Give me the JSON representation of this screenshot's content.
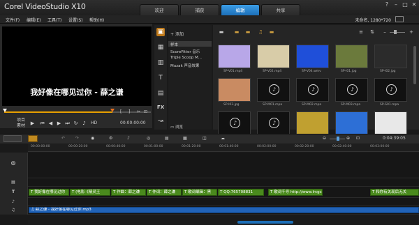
{
  "app": {
    "title": "Corel VideoStudio X10",
    "tabs": [
      {
        "label": "欢迎",
        "active": false
      },
      {
        "label": "捕获",
        "active": false
      },
      {
        "label": "编辑",
        "active": true
      },
      {
        "label": "共享",
        "active": false
      }
    ],
    "window_controls": [
      "?",
      "–",
      "□",
      "✕"
    ]
  },
  "menu": {
    "items": [
      "文件(F)",
      "编辑(E)",
      "工具(T)",
      "设置(S)",
      "帮助(H)"
    ],
    "project_resolution": "未命名, 1280*720"
  },
  "preview": {
    "subtitle": "我好像在哪见过你 - 薛之谦",
    "progress_fraction": 0.74,
    "mode_labels": [
      "项目",
      "素材"
    ],
    "hd_label": "HD",
    "timecode": "00:00:00:00",
    "bracket_in": "[",
    "bracket_out": "]"
  },
  "library": {
    "add_label": "添加",
    "folders": [
      "样本",
      "ScoreFitter 音乐",
      "Triple Scoop M...",
      "Muzak 声音效果"
    ],
    "browse_label": "浏览",
    "thumbnails": [
      {
        "label": "SP-V01.mp4",
        "color": "#b8a7e8"
      },
      {
        "label": "SP-V02.mp4",
        "color": "#d8cca8"
      },
      {
        "label": "SP-V04.wmv",
        "color": "#1f4fd9"
      },
      {
        "label": "SP-I01.jpg",
        "color": "#6b7a3c"
      },
      {
        "label": "SP-I02.jpg",
        "color": "#2b2b2b"
      },
      {
        "label": "SP-I03.jpg",
        "color": "#c98b62"
      },
      {
        "label": "SP-M01.mpa",
        "color": "#111111"
      },
      {
        "label": "SP-M02.mpa",
        "color": "#111111"
      },
      {
        "label": "SP-M03.mpa",
        "color": "#111111"
      },
      {
        "label": "SP-S01.mpa",
        "color": "#111111"
      },
      {
        "label": "",
        "color": "#111111"
      },
      {
        "label": "",
        "color": "#111111"
      },
      {
        "label": "",
        "color": "#c0a030"
      },
      {
        "label": "",
        "color": "#2d6fd6"
      },
      {
        "label": "",
        "color": "#e8e8e8"
      }
    ]
  },
  "timeline": {
    "duration": "0:04:39:05",
    "ruler": [
      "00:00:00:00",
      "00:00:20:00",
      "00:00:40:00",
      "00:01:00:00",
      "00:01:20:00",
      "00:01:40:00",
      "00:02:00:00",
      "00:02:20:00",
      "00:02:40:00",
      "00:03:00:00"
    ],
    "title_clips": [
      "我好像在哪见过你",
      "(电影《精灵王",
      "作曲：薛之谦",
      "作词：薛之谦",
      "歌词编辑：黑",
      "QQ:765708831",
      "歌词千寻 http://www.lrcgc",
      "和你有关现后无关"
    ],
    "music_clip": "薛之谦 - 我好像在哪见过你.mp3"
  }
}
